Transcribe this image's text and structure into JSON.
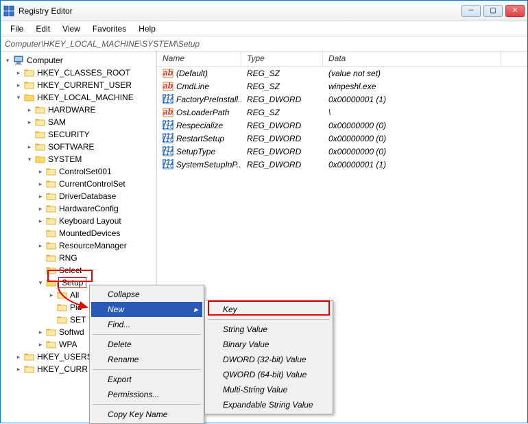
{
  "titlebar": {
    "title": "Registry Editor"
  },
  "menu": {
    "file": "File",
    "edit": "Edit",
    "view": "View",
    "favorites": "Favorites",
    "help": "Help"
  },
  "address": "Computer\\HKEY_LOCAL_MACHINE\\SYSTEM\\Setup",
  "tree": {
    "root": "Computer",
    "nodes": {
      "hkcr": "HKEY_CLASSES_ROOT",
      "hkcu": "HKEY_CURRENT_USER",
      "hklm": "HKEY_LOCAL_MACHINE",
      "hardware": "HARDWARE",
      "sam": "SAM",
      "security": "SECURITY",
      "software": "SOFTWARE",
      "system": "SYSTEM",
      "cs001": "ControlSet001",
      "ccs": "CurrentControlSet",
      "driverdb": "DriverDatabase",
      "hwconfig": "HardwareConfig",
      "kblayout": "Keyboard Layout",
      "mounted": "MountedDevices",
      "resmgr": "ResourceManager",
      "rng": "RNG",
      "select": "Select",
      "setup": "Setup",
      "all": "All",
      "pid": "Pid",
      "set": "SET",
      "softw2": "Softwd",
      "wpa": "WPA",
      "hku": "HKEY_USERS",
      "hkcc": "HKEY_CURR"
    }
  },
  "list": {
    "headers": {
      "name": "Name",
      "type": "Type",
      "data": "Data"
    },
    "rows": [
      {
        "icon": "string",
        "name": "(Default)",
        "type": "REG_SZ",
        "data": "(value not set)"
      },
      {
        "icon": "string",
        "name": "CmdLine",
        "type": "REG_SZ",
        "data": "winpeshl.exe"
      },
      {
        "icon": "binary",
        "name": "FactoryPreInstall...",
        "type": "REG_DWORD",
        "data": "0x00000001 (1)"
      },
      {
        "icon": "string",
        "name": "OsLoaderPath",
        "type": "REG_SZ",
        "data": "\\"
      },
      {
        "icon": "binary",
        "name": "Respecialize",
        "type": "REG_DWORD",
        "data": "0x00000000 (0)"
      },
      {
        "icon": "binary",
        "name": "RestartSetup",
        "type": "REG_DWORD",
        "data": "0x00000000 (0)"
      },
      {
        "icon": "binary",
        "name": "SetupType",
        "type": "REG_DWORD",
        "data": "0x00000000 (0)"
      },
      {
        "icon": "binary",
        "name": "SystemSetupInP...",
        "type": "REG_DWORD",
        "data": "0x00000001 (1)"
      }
    ]
  },
  "contextmenu": {
    "collapse": "Collapse",
    "new": "New",
    "find": "Find...",
    "delete": "Delete",
    "rename": "Rename",
    "export": "Export",
    "permissions": "Permissions...",
    "copyname": "Copy Key Name"
  },
  "submenu": {
    "key": "Key",
    "string": "String Value",
    "binary": "Binary Value",
    "dword": "DWORD (32-bit) Value",
    "qword": "QWORD (64-bit) Value",
    "multi": "Multi-String Value",
    "expand": "Expandable String Value"
  }
}
